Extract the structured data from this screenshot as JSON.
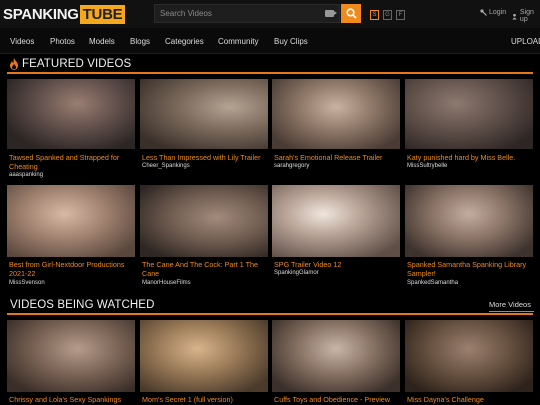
{
  "header": {
    "logo_part1": "SPANKING",
    "logo_part2": "TUBE",
    "search_placeholder": "Search Videos",
    "filters": [
      "S",
      "G",
      "F"
    ],
    "login": "Login",
    "signup": "Sign up"
  },
  "nav": [
    "Videos",
    "Photos",
    "Models",
    "Blogs",
    "Categories",
    "Community",
    "Buy Clips",
    "UPLOAD"
  ],
  "featured": {
    "title": "FEATURED VIDEOS",
    "videos": [
      {
        "title": "Tawsed Spanked and Strapped for Cheating",
        "user": "aaaspanking"
      },
      {
        "title": "Less Than Impressed with Lily Trailer",
        "user": "Cheer_Spankings"
      },
      {
        "title": "Sarah's Emotional Release Trailer",
        "user": "sarahgregory"
      },
      {
        "title": "Katy punished hard by Miss Belle.",
        "user": "MissSultrybelle"
      },
      {
        "title": "Best from Girl-Nextdoor Productions 2021-22",
        "user": "MissSvenson"
      },
      {
        "title": "The Cane And The Cock: Part 1 The Cane",
        "user": "ManorHouseFilms"
      },
      {
        "title": "SPG Trailer Video 12",
        "user": "SpankingGlamor"
      },
      {
        "title": "Spanked Samantha Spanking Library Sampler!",
        "user": "SpankedSamantha"
      }
    ]
  },
  "watched": {
    "title": "VIDEOS BEING WATCHED",
    "more": "More Videos",
    "videos": [
      {
        "title": "Chrissy and Lola's Sexy Spankings"
      },
      {
        "title": "Mom's Secret 1 (full version)"
      },
      {
        "title": "Cuffs Toys and Obedience - Preview"
      },
      {
        "title": "Miss Dayna's Challenge"
      }
    ]
  },
  "colors": {
    "accent": "#f08a1c",
    "background": "#000000",
    "bar": "#111111"
  }
}
